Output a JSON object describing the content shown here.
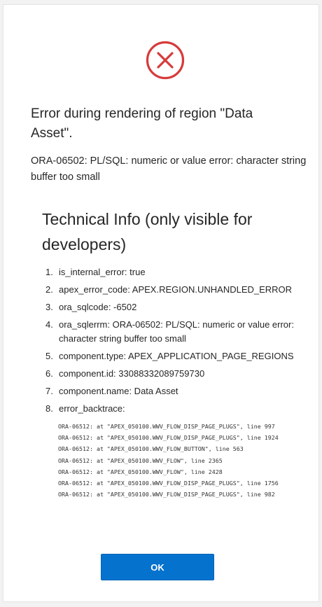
{
  "dialog": {
    "icon": "error-x-circle-icon",
    "title": "Error during rendering of region \"Data Asset\".",
    "message": "ORA-06502: PL/SQL: numeric or value error: character string buffer too small",
    "technical_heading": "Technical Info (only visible for developers)",
    "technical_items": [
      {
        "number": "1.",
        "text": "is_internal_error: true"
      },
      {
        "number": "2.",
        "text": "apex_error_code: APEX.REGION.UNHANDLED_ERROR"
      },
      {
        "number": "3.",
        "text": "ora_sqlcode: -6502"
      },
      {
        "number": "4.",
        "text": "ora_sqlerrm: ORA-06502: PL/SQL: numeric or value error: character string buffer too small"
      },
      {
        "number": "5.",
        "text": "component.type: APEX_APPLICATION_PAGE_REGIONS"
      },
      {
        "number": "6.",
        "text": "component.id: 33088332089759730"
      },
      {
        "number": "7.",
        "text": "component.name: Data Asset"
      },
      {
        "number": "8.",
        "text": "error_backtrace:"
      }
    ],
    "backtrace": [
      "ORA-06512: at \"APEX_050100.WWV_FLOW_DISP_PAGE_PLUGS\", line 997",
      "ORA-06512: at \"APEX_050100.WWV_FLOW_DISP_PAGE_PLUGS\", line 1924",
      "ORA-06512: at \"APEX_050100.WWV_FLOW_BUTTON\", line 563",
      "ORA-06512: at \"APEX_050100.WWV_FLOW\", line 2365",
      "ORA-06512: at \"APEX_050100.WWV_FLOW\", line 2428",
      "ORA-06512: at \"APEX_050100.WWV_FLOW_DISP_PAGE_PLUGS\", line 1756",
      "ORA-06512: at \"APEX_050100.WWV_FLOW_DISP_PAGE_PLUGS\", line 982"
    ],
    "ok_label": "OK",
    "colors": {
      "icon_red": "#d63b3b",
      "button_blue": "#0572ce",
      "text": "#262626"
    }
  }
}
